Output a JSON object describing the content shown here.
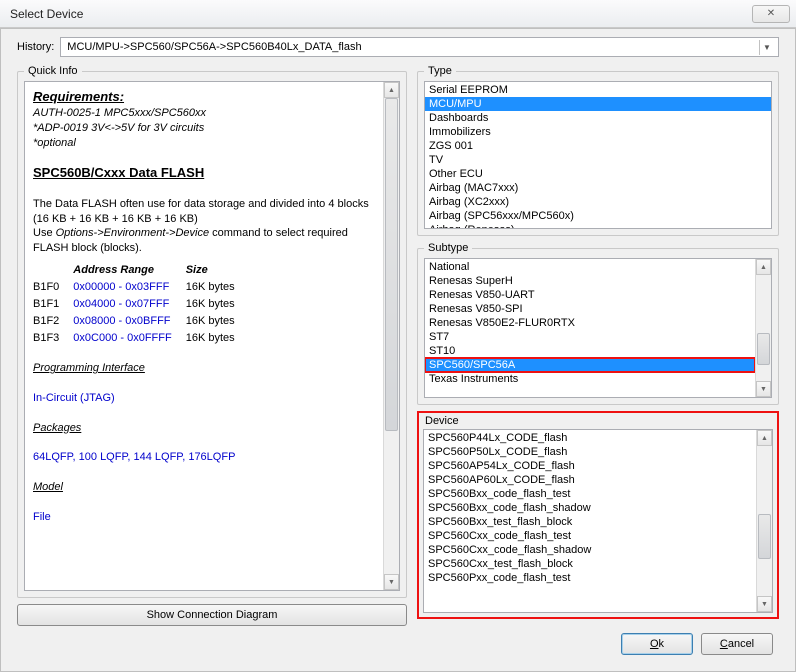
{
  "window": {
    "title": "Select Device",
    "close_glyph": "✕"
  },
  "history": {
    "label": "History:",
    "value": "MCU/MPU->SPC560/SPC56A->SPC560B40Lx_DATA_flash"
  },
  "quick_info": {
    "legend": "Quick Info",
    "requirements_heading": "Requirements:",
    "req_line1": "AUTH-0025-1 MPC5xxx/SPC560xx",
    "req_line2": "*ADP-0019 3V<->5V for 3V circuits",
    "req_line3": "*optional",
    "section_heading": "SPC560B/Cxxx Data FLASH",
    "para1": "The Data FLASH often use for data storage and divided into 4 blocks (16 KB + 16 KB + 16 KB + 16 KB)",
    "para2a": "Use ",
    "para2b_ital": "Options->Environment->Device",
    "para2c": " command to select required FLASH block (blocks).",
    "addr_header": "Address Range",
    "size_header": "Size",
    "rows": [
      {
        "blk": "B1F0",
        "range": "0x00000 - 0x03FFF",
        "size": "16K bytes"
      },
      {
        "blk": "B1F1",
        "range": "0x04000 - 0x07FFF",
        "size": "16K bytes"
      },
      {
        "blk": "B1F2",
        "range": "0x08000 - 0x0BFFF",
        "size": "16K bytes"
      },
      {
        "blk": "B1F3",
        "range": "0x0C000 - 0x0FFFF",
        "size": "16K bytes"
      }
    ],
    "prog_if_heading": "Programming Interface",
    "prog_if_value": "In-Circuit (JTAG)",
    "packages_heading": "Packages",
    "packages_value": "64LQFP, 100 LQFP, 144 LQFP, 176LQFP",
    "model_heading": "Model",
    "model_value": "File"
  },
  "type": {
    "legend": "Type",
    "items": [
      "Serial EEPROM",
      "MCU/MPU",
      "Dashboards",
      "Immobilizers",
      "ZGS 001",
      "TV",
      "Other ECU",
      "Airbag (MAC7xxx)",
      "Airbag (XC2xxx)",
      "Airbag (SPC56xxx/MPC560x)",
      "Airbag (Renesas)"
    ],
    "selected_index": 1
  },
  "subtype": {
    "legend": "Subtype",
    "items": [
      "National",
      "Renesas SuperH",
      "Renesas V850-UART",
      "Renesas V850-SPI",
      "Renesas V850E2-FLUR0RTX",
      "ST7",
      "ST10",
      "SPC560/SPC56A",
      "Texas Instruments"
    ],
    "selected_index": 7
  },
  "device": {
    "legend": "Device",
    "items": [
      "SPC560P44Lx_CODE_flash",
      "SPC560P50Lx_CODE_flash",
      "SPC560AP54Lx_CODE_flash",
      "SPC560AP60Lx_CODE_flash",
      "SPC560Bxx_code_flash_test",
      "SPC560Bxx_code_flash_shadow",
      "SPC560Bxx_test_flash_block",
      "SPC560Cxx_code_flash_test",
      "SPC560Cxx_code_flash_shadow",
      "SPC560Cxx_test_flash_block",
      "SPC560Pxx_code_flash_test"
    ]
  },
  "buttons": {
    "connection_diagram": "Show Connection Diagram",
    "ok": "Ok",
    "cancel": "Cancel"
  }
}
